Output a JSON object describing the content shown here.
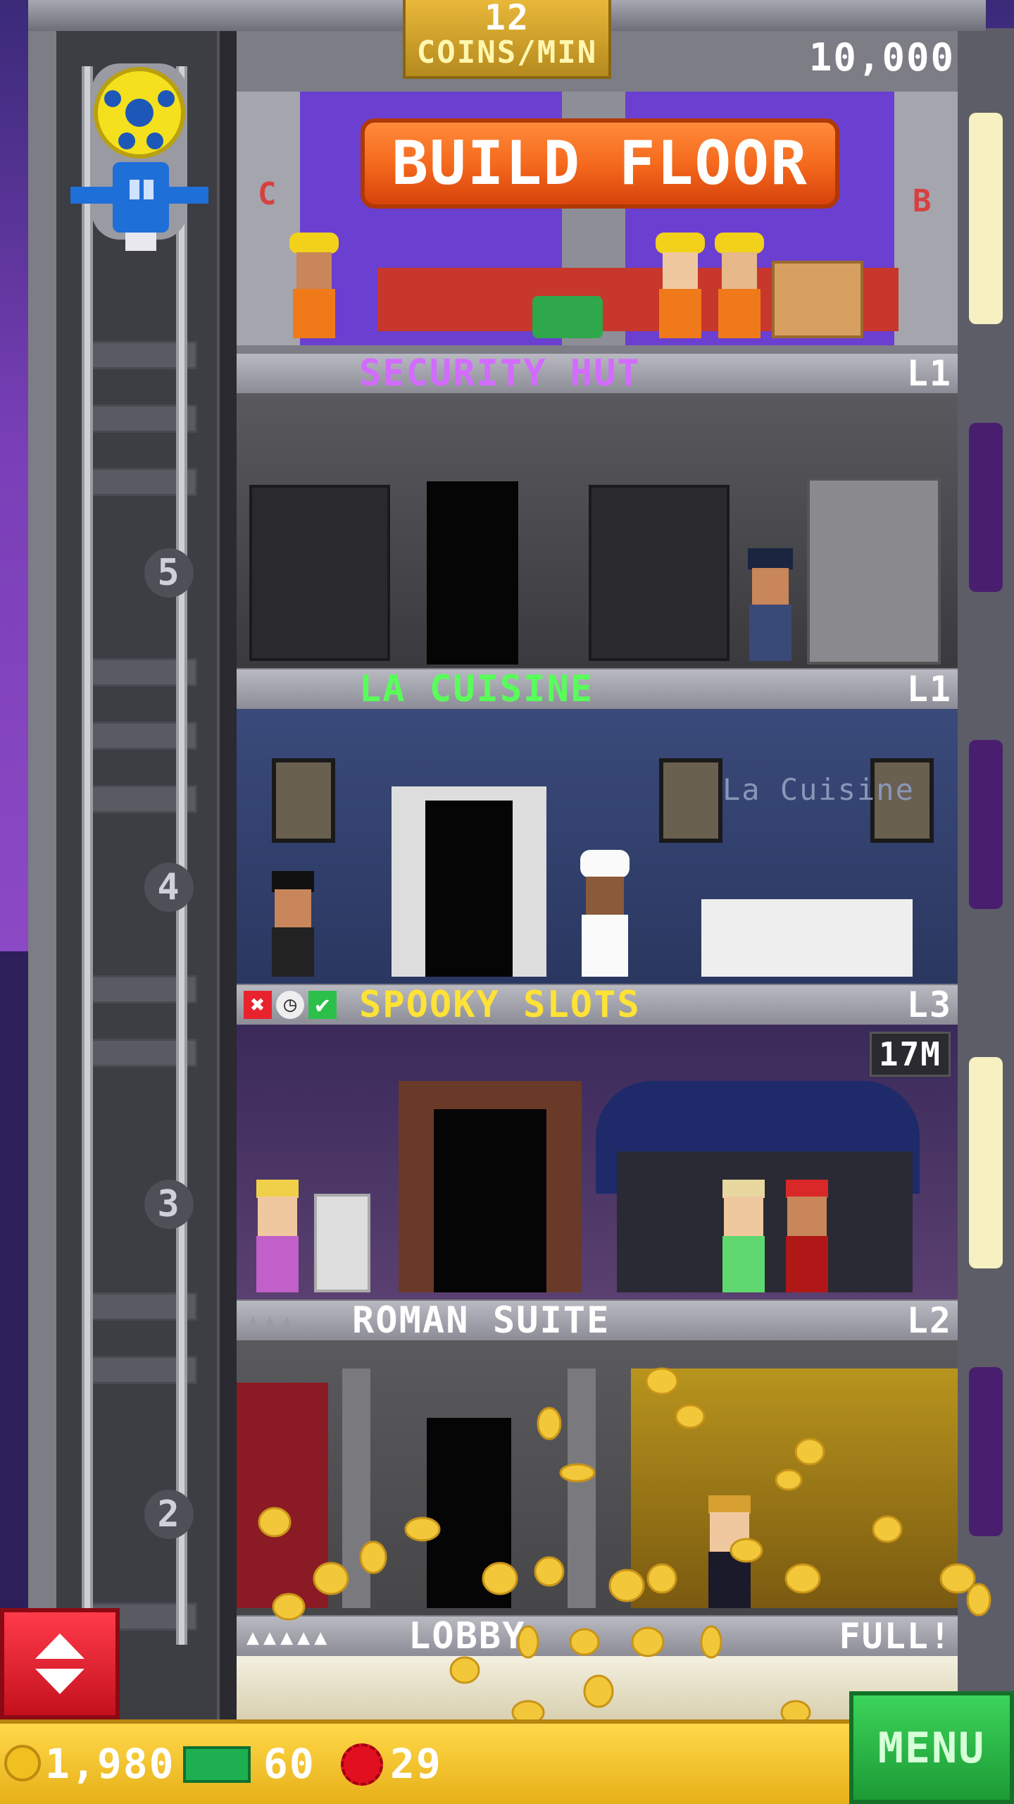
{
  "header": {
    "coin_rate": "12",
    "coin_rate_unit": "COINS/MIN",
    "top_coins": "10,000"
  },
  "build_floor": {
    "button_label": "BUILD FLOOR",
    "sign_left": "C",
    "sign_right": "B"
  },
  "floors": [
    {
      "name": "SECURITY HUT",
      "level": "L1",
      "name_color": "#d36bff"
    },
    {
      "name": "LA CUISINE",
      "level": "L1",
      "name_color": "#58ff5a",
      "sign": "La Cuisine"
    },
    {
      "name": "SPOOKY SLOTS",
      "level": "L3",
      "name_color": "#ffe236",
      "stock_badge": "17M"
    },
    {
      "name": "ROMAN SUITE",
      "level": "L2",
      "name_color": "#ffffff"
    },
    {
      "name": "LOBBY",
      "level": "FULL!",
      "name_color": "#ffffff"
    }
  ],
  "elevator": {
    "floor_numbers": [
      "5",
      "4",
      "3",
      "2"
    ]
  },
  "hud": {
    "coins": "1,980",
    "bux": "60",
    "tickets": "29",
    "menu_label": "MENU"
  },
  "colors": {
    "coin_gold": "#f0c020",
    "menu_green": "#2bbd48",
    "elevator_red": "#e81c2c",
    "build_orange": "#f56a1e"
  },
  "icons": [
    "elevator-car-icon",
    "coin-icon",
    "bux-icon",
    "ticket-icon",
    "elevator-updown-icon",
    "status-x-icon",
    "status-clock-icon",
    "status-check-icon",
    "resident-slot-icon"
  ]
}
